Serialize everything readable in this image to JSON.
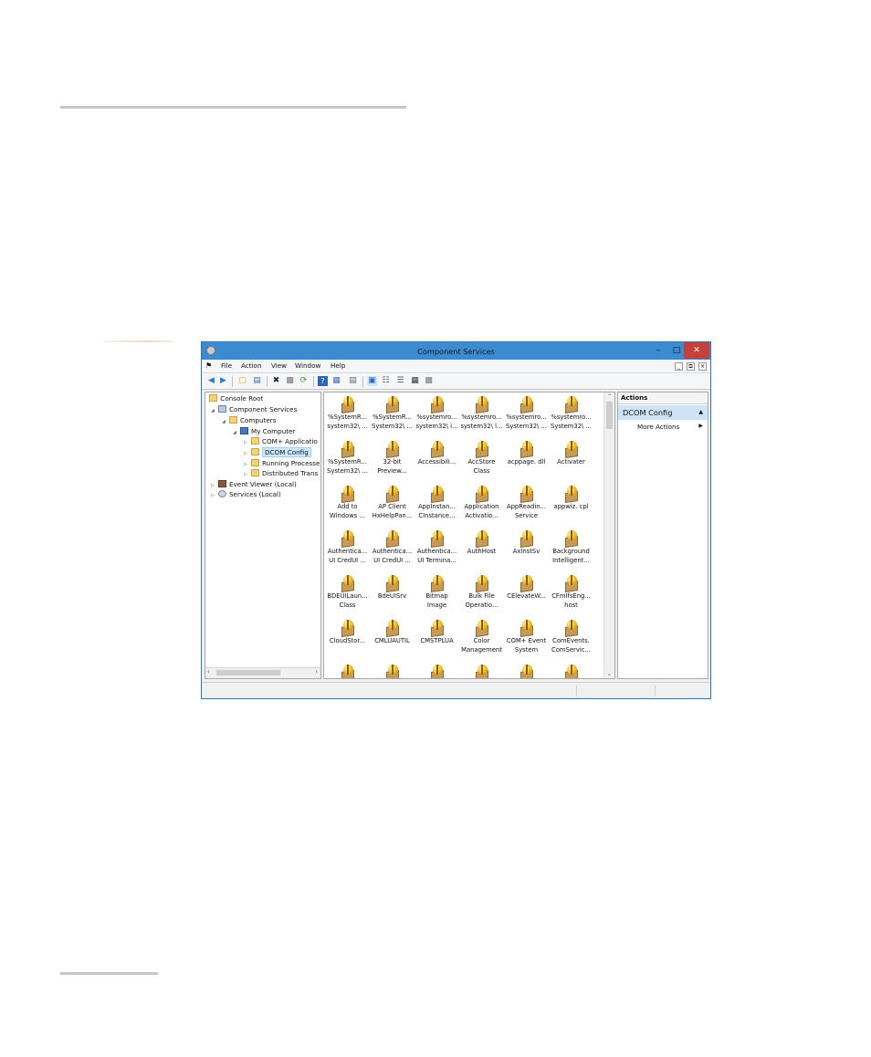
{
  "window": {
    "title": "Component Services",
    "colors": {
      "titlebar": "#3c8ad0",
      "close": "#c7413a",
      "selection": "#cce8ff",
      "actions_highlight": "#cfe3f6"
    }
  },
  "menu": {
    "items": [
      "File",
      "Action",
      "View",
      "Window",
      "Help"
    ]
  },
  "toolbar": {
    "icons": [
      "back-icon",
      "forward-icon",
      "up-folder-icon",
      "show-hide-tree-icon",
      "delete-icon",
      "properties-icon",
      "refresh-icon",
      "help-icon",
      "show-hide-action-pane-icon",
      "export-list-icon",
      "large-icons-view-icon",
      "small-icons-view-icon",
      "list-view-icon",
      "detail-view-icon",
      "custom-view-icon"
    ]
  },
  "tree": {
    "items": [
      {
        "label": "Console Root",
        "level": 0,
        "icon": "folder-icon",
        "expander": "none"
      },
      {
        "label": "Component Services",
        "level": 1,
        "icon": "component-services-icon",
        "expander": "expanded"
      },
      {
        "label": "Computers",
        "level": 2,
        "icon": "folder-icon",
        "expander": "expanded"
      },
      {
        "label": "My Computer",
        "level": 3,
        "icon": "computer-icon",
        "expander": "expanded"
      },
      {
        "label": "COM+ Applicatio",
        "level": 4,
        "icon": "folder-icon",
        "expander": "collapsed"
      },
      {
        "label": "DCOM Config",
        "level": 4,
        "icon": "folder-icon",
        "expander": "collapsed",
        "selected": true
      },
      {
        "label": "Running Processe",
        "level": 4,
        "icon": "folder-icon",
        "expander": "collapsed"
      },
      {
        "label": "Distributed Trans",
        "level": 4,
        "icon": "folder-icon",
        "expander": "collapsed"
      },
      {
        "label": "Event Viewer (Local)",
        "level": 1,
        "icon": "event-viewer-icon",
        "expander": "collapsed"
      },
      {
        "label": "Services (Local)",
        "level": 1,
        "icon": "services-icon",
        "expander": "collapsed"
      }
    ]
  },
  "list": {
    "items": [
      [
        "%SystemR...",
        "system32\\ ..."
      ],
      [
        "%SystemR...",
        "System32\\ ..."
      ],
      [
        "%systemro...",
        "system32\\ i..."
      ],
      [
        "%systemro...",
        "system32\\ l..."
      ],
      [
        "%systemro...",
        "System32\\ ..."
      ],
      [
        "%systemro...",
        "System32\\ ..."
      ],
      [
        "%SystemR...",
        "System32\\ ..."
      ],
      [
        "32-bit",
        "Preview..."
      ],
      [
        "Accessibili...",
        ""
      ],
      [
        "AccStore",
        "Class"
      ],
      [
        "acppage. dll",
        ""
      ],
      [
        "Activater",
        ""
      ],
      [
        "Add to",
        "Windows ..."
      ],
      [
        "AP Client",
        "HxHelpPan..."
      ],
      [
        "AppInstan...",
        "CInstance..."
      ],
      [
        "Application",
        "Activatio..."
      ],
      [
        "AppReadin...",
        "Service"
      ],
      [
        "appwiz. cpl",
        ""
      ],
      [
        "Authentica...",
        "UI CredUI ..."
      ],
      [
        "Authentica...",
        "UI CredUI ..."
      ],
      [
        "Authentica...",
        "UI Termina..."
      ],
      [
        "AuthHost",
        ""
      ],
      [
        "AxInstSv",
        ""
      ],
      [
        "Background",
        "Intelligent..."
      ],
      [
        "BDEUILaun...",
        "Class"
      ],
      [
        "BdeUISrv",
        ""
      ],
      [
        "Bitmap",
        "Image"
      ],
      [
        "Bulk File",
        "Operatio..."
      ],
      [
        "CElevateW...",
        ""
      ],
      [
        "CFmIfsEng...",
        "host"
      ],
      [
        "CloudStor...",
        ""
      ],
      [
        "CMLUAUTIL",
        ""
      ],
      [
        "CMSTPLUA",
        ""
      ],
      [
        "Color",
        "Management"
      ],
      [
        "COM+ Event",
        "System"
      ],
      [
        "ComEvents.",
        "ComServic..."
      ],
      [
        "",
        ""
      ],
      [
        "",
        ""
      ],
      [
        "",
        ""
      ],
      [
        "",
        ""
      ],
      [
        "",
        ""
      ],
      [
        "",
        ""
      ]
    ]
  },
  "actions": {
    "header": "Actions",
    "section": "DCOM Config",
    "item": "More Actions"
  }
}
